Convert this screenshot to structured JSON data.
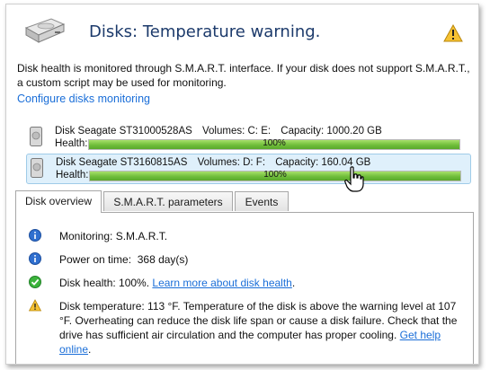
{
  "header": {
    "title": "Disks: Temperature warning.",
    "drive_icon": "hard-drive-icon",
    "warning_icon": "warning-icon"
  },
  "description": "Disk health is monitored through S.M.A.R.T. interface. If your disk does not support S.M.A.R.T., a custom script may be used for monitoring.",
  "config_link": "Configure disks monitoring",
  "disks": [
    {
      "name": "Disk Seagate ST31000528AS",
      "volumes": "Volumes: C: E:",
      "capacity": "Capacity: 1000.20 GB",
      "health_label": "Health:",
      "health_text": "100%",
      "health_fraction": 1.0,
      "selected": false
    },
    {
      "name": "Disk Seagate ST3160815AS",
      "volumes": "Volumes: D: F:",
      "capacity": "Capacity: 160.04 GB",
      "health_label": "Health:",
      "health_text": "100%",
      "health_fraction": 1.0,
      "selected": true
    }
  ],
  "tabs": [
    {
      "label": "Disk overview",
      "active": true
    },
    {
      "label": "S.M.A.R.T. parameters",
      "active": false
    },
    {
      "label": "Events",
      "active": false
    }
  ],
  "overview": {
    "monitoring": "Monitoring: S.M.A.R.T.",
    "power_on_prefix": "Power on time:",
    "power_on_value": "368 day(s)",
    "health_prefix": "Disk health: 100%.",
    "health_link": "Learn more about disk health",
    "health_suffix": ".",
    "temp_text": "Disk temperature: 113 °F. Temperature of the disk is above the warning level at 107 °F. Overheating can reduce the disk life span or cause a disk failure. Check that the drive has sufficient air circulation and the computer has proper cooling.",
    "temp_link": "Get help online",
    "temp_suffix": "."
  },
  "colors": {
    "title": "#1c3a6b",
    "link": "#1a6ed8",
    "health_bar": "#6fbe3a",
    "selected_row": "#dff0fb"
  }
}
